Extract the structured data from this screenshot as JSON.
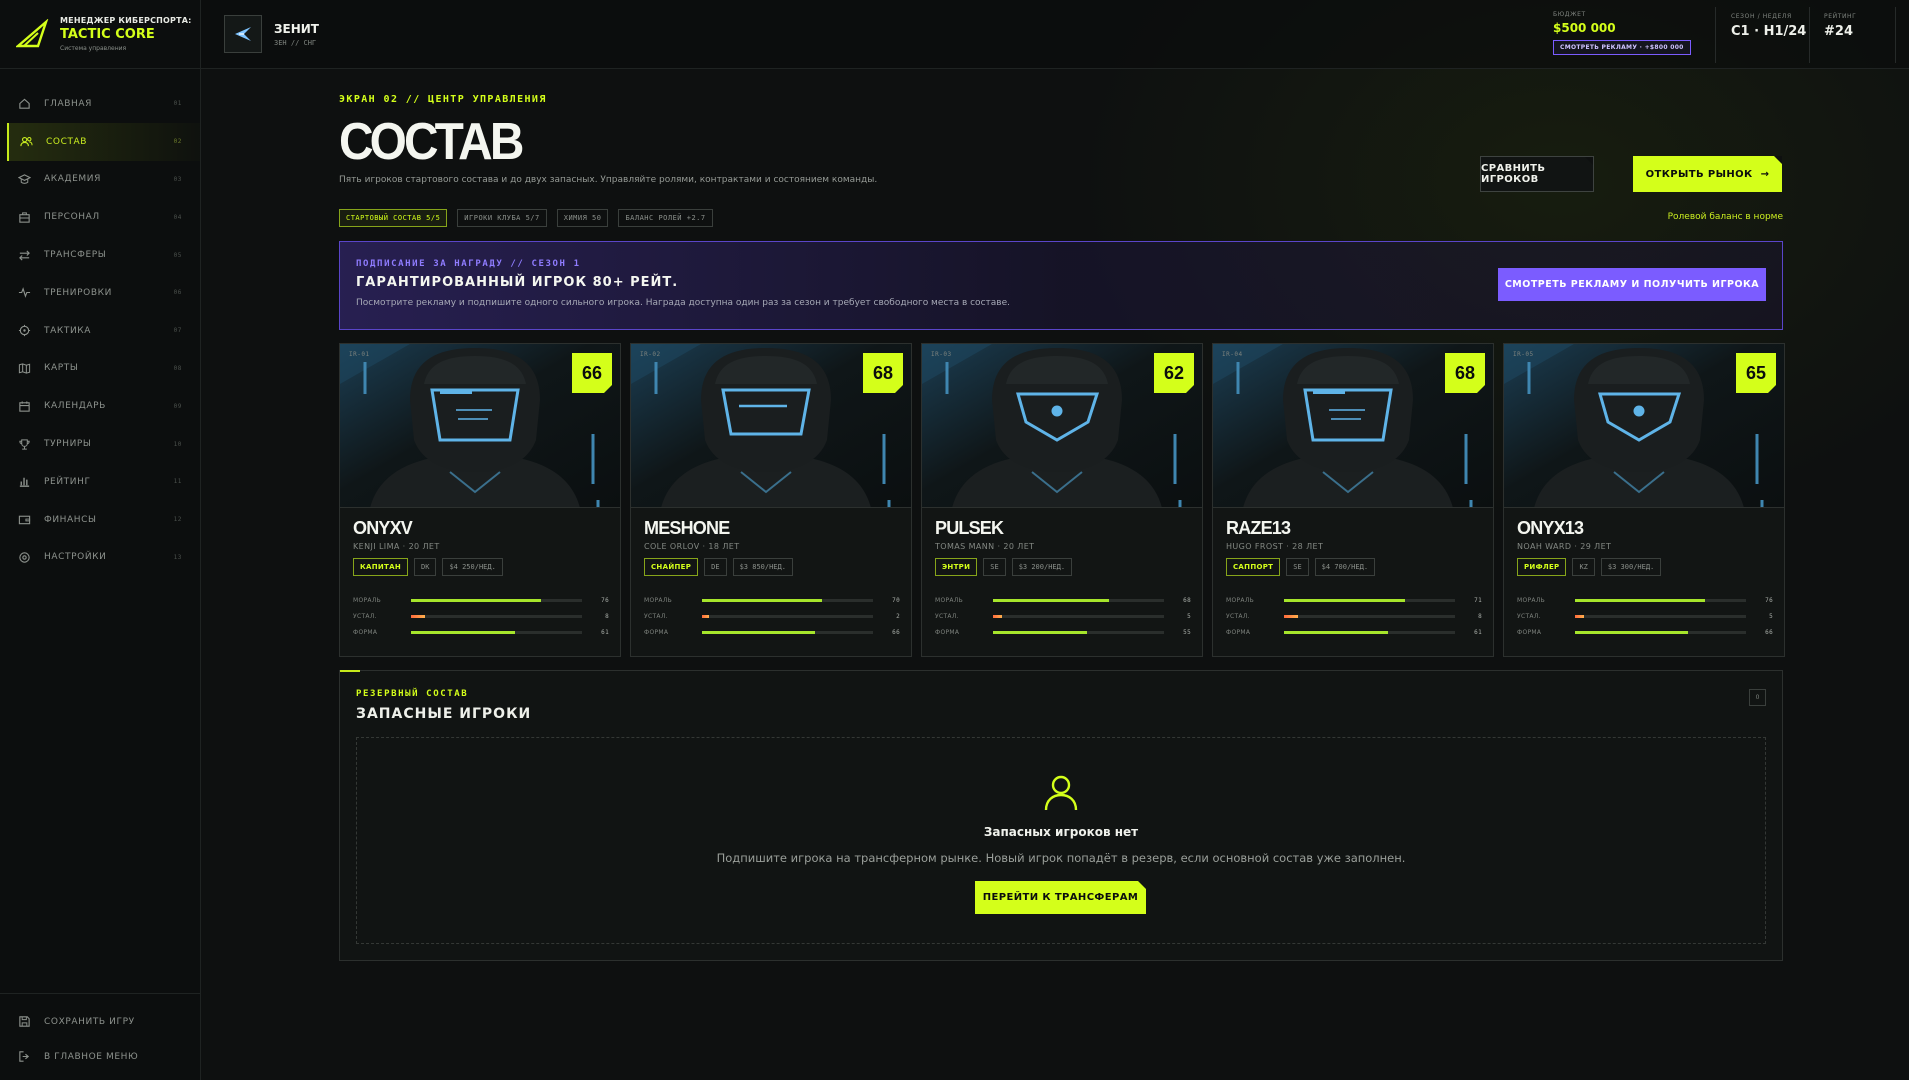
{
  "brand": {
    "line1": "МЕНЕДЖЕР КИБЕРСПОРТА:",
    "line2": "TACTIC CORE",
    "line3": "Система управления"
  },
  "sidebar": {
    "items": [
      {
        "label": "ГЛАВНАЯ",
        "num": "01",
        "icon": "home-icon"
      },
      {
        "label": "СОСТАВ",
        "num": "02",
        "icon": "users-icon"
      },
      {
        "label": "АКАДЕМИЯ",
        "num": "03",
        "icon": "graduation-cap-icon"
      },
      {
        "label": "ПЕРСОНАЛ",
        "num": "04",
        "icon": "briefcase-icon"
      },
      {
        "label": "ТРАНСФЕРЫ",
        "num": "05",
        "icon": "transfer-arrows-icon"
      },
      {
        "label": "ТРЕНИРОВКИ",
        "num": "06",
        "icon": "activity-icon"
      },
      {
        "label": "ТАКТИКА",
        "num": "07",
        "icon": "crosshair-icon"
      },
      {
        "label": "КАРТЫ",
        "num": "08",
        "icon": "map-icon"
      },
      {
        "label": "КАЛЕНДАРЬ",
        "num": "09",
        "icon": "calendar-icon"
      },
      {
        "label": "ТУРНИРЫ",
        "num": "10",
        "icon": "trophy-icon"
      },
      {
        "label": "РЕЙТИНГ",
        "num": "11",
        "icon": "bar-chart-icon"
      },
      {
        "label": "ФИНАНСЫ",
        "num": "12",
        "icon": "wallet-icon"
      },
      {
        "label": "НАСТРОЙКИ",
        "num": "13",
        "icon": "settings-icon"
      }
    ],
    "bottom": [
      {
        "label": "СОХРАНИТЬ ИГРУ",
        "icon": "save-icon"
      },
      {
        "label": "В ГЛАВНОЕ МЕНЮ",
        "icon": "logout-icon"
      }
    ]
  },
  "topbar": {
    "team_name": "ЗЕНИТ",
    "team_sub": "ЗЕН // СНГ",
    "budget_label": "БЮДЖЕТ",
    "budget_value": "$500 000",
    "ad_button": "СМОТРЕТЬ РЕКЛАМУ · +$800 000",
    "season_label": "СЕЗОН / НЕДЕЛЯ",
    "season_value": "C1 · H1/24",
    "rating_label": "РЕЙТИНГ",
    "rating_value": "#24"
  },
  "page": {
    "screen_tag": "ЭКРАН 02 // ЦЕНТР УПРАВЛЕНИЯ",
    "title": "СОСТАВ",
    "subtitle": "Пять игроков стартового состава и до двух запасных. Управляйте ролями, контрактами и состоянием команды.",
    "compare_button": "СРАВНИТЬ ИГРОКОВ",
    "market_button": "ОТКРЫТЬ РЫНОК",
    "role_balance": "Ролевой баланс в норме"
  },
  "chips": [
    "СТАРТОВЫЙ СОСТАВ 5/5",
    "ИГРОКИ КЛУБА 5/7",
    "ХИМИЯ 50",
    "БАЛАНС РОЛЕЙ +2.7"
  ],
  "reward": {
    "tag": "ПОДПИСАНИЕ ЗА НАГРАДУ // СЕЗОН 1",
    "title": "ГАРАНТИРОВАННЫЙ ИГРОК 80+ РЕЙТ.",
    "desc": "Посмотрите рекламу и подпишите одного сильного игрока. Награда доступна один раз за сезон и требует свободного места в составе.",
    "button": "СМОТРЕТЬ РЕКЛАМУ И ПОЛУЧИТЬ ИГРОКА"
  },
  "stat_labels": {
    "morale": "МОРАЛЬ",
    "fatigue": "УСТАЛ.",
    "form": "ФОРМА"
  },
  "players": [
    {
      "id": "IR-01",
      "rating": "66",
      "nick": "ONYXV",
      "real": "KENJI LIMA · 20 ЛЕТ",
      "role": "КАПИТАН",
      "region": "DK",
      "salary": "$4 250/НЕД.",
      "morale": 76,
      "fatigue": 8,
      "form": 61,
      "visor": "rect"
    },
    {
      "id": "IR-02",
      "rating": "68",
      "nick": "MESHONE",
      "real": "COLE ORLOV · 18 ЛЕТ",
      "role": "СНАЙПЕР",
      "region": "DE",
      "salary": "$3 850/НЕД.",
      "morale": 70,
      "fatigue": 2,
      "form": 66,
      "visor": "rect2"
    },
    {
      "id": "IR-03",
      "rating": "62",
      "nick": "PULSEK",
      "real": "TOMAS MANN · 20 ЛЕТ",
      "role": "ЭНТРИ",
      "region": "SE",
      "salary": "$3 200/НЕД.",
      "morale": 68,
      "fatigue": 5,
      "form": 55,
      "visor": "dot"
    },
    {
      "id": "IR-04",
      "rating": "68",
      "nick": "RAZE13",
      "real": "HUGO FROST · 28 ЛЕТ",
      "role": "САППОРТ",
      "region": "SE",
      "salary": "$4 700/НЕД.",
      "morale": 71,
      "fatigue": 8,
      "form": 61,
      "visor": "rect"
    },
    {
      "id": "IR-05",
      "rating": "65",
      "nick": "ONYX13",
      "real": "NOAH WARD · 29 ЛЕТ",
      "role": "РИФЛЕР",
      "region": "KZ",
      "salary": "$3 300/НЕД.",
      "morale": 76,
      "fatigue": 5,
      "form": 66,
      "visor": "dot"
    }
  ],
  "reserve": {
    "tag": "РЕЗЕРВНЫЙ СОСТАВ",
    "title": "ЗАПАСНЫЕ ИГРОКИ",
    "count": "0",
    "empty_title": "Запасных игроков нет",
    "empty_desc": "Подпишите игрока на трансферном рынке. Новый игрок попадёт в резерв, если основной состав уже заполнен.",
    "button": "ПЕРЕЙТИ К ТРАНСФЕРАМ"
  }
}
